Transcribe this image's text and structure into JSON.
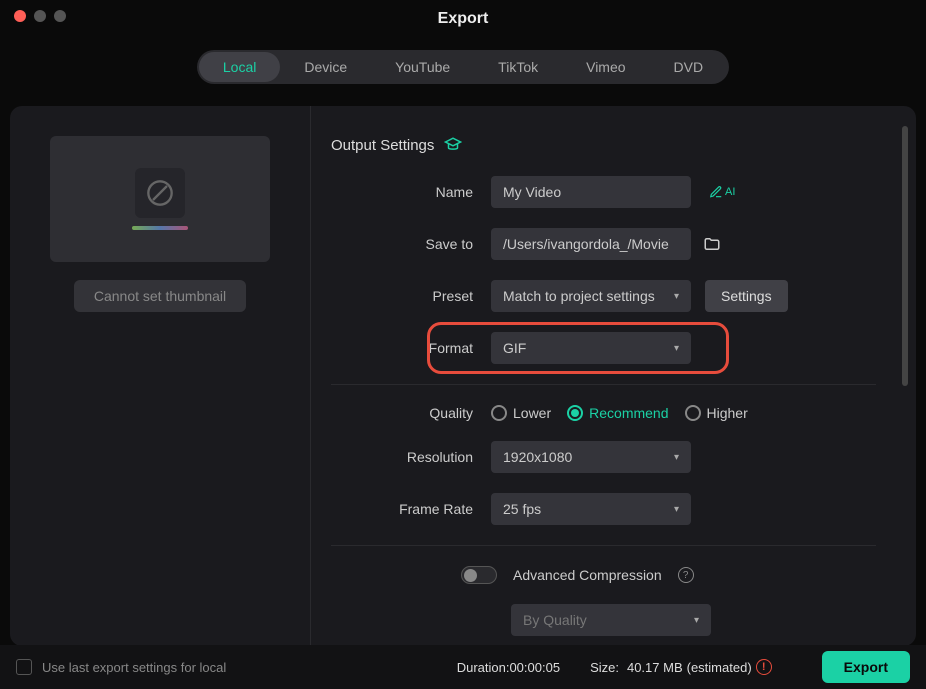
{
  "title": "Export",
  "tabs": [
    "Local",
    "Device",
    "YouTube",
    "TikTok",
    "Vimeo",
    "DVD"
  ],
  "active_tab": "Local",
  "thumbnail_caption": "Cannot set thumbnail",
  "section_title": "Output Settings",
  "labels": {
    "name": "Name",
    "save_to": "Save to",
    "preset": "Preset",
    "format": "Format",
    "quality": "Quality",
    "resolution": "Resolution",
    "frame_rate": "Frame Rate",
    "advanced": "Advanced Compression"
  },
  "values": {
    "name": "My Video",
    "save_to": "/Users/ivangordola_/Movie",
    "preset": "Match to project settings",
    "format": "GIF",
    "resolution": "1920x1080",
    "frame_rate": "25 fps",
    "compression_mode": "By Quality"
  },
  "settings_btn": "Settings",
  "ai_label": "AI",
  "quality_options": [
    "Lower",
    "Recommend",
    "Higher"
  ],
  "quality_selected": "Recommend",
  "footer": {
    "checkbox_label": "Use last export settings for local",
    "duration_label": "Duration:",
    "duration_value": "00:00:05",
    "size_label": "Size:",
    "size_value": "40.17 MB",
    "size_suffix": "(estimated)",
    "export_btn": "Export"
  },
  "colors": {
    "accent": "#1bd1a5",
    "highlight": "#e74c3c"
  }
}
